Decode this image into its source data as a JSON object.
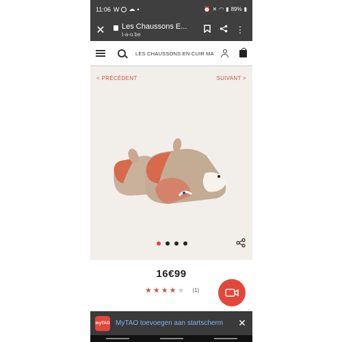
{
  "statusbar": {
    "time": "11:06",
    "battery": "89%"
  },
  "browser": {
    "title": "Les Chaussons E...",
    "domain": "t-a-o.be"
  },
  "site": {
    "breadcrumb": "LES CHAUSSONS EN CUIR MA..."
  },
  "product": {
    "prev": "< PRÉCÉDENT",
    "next": "SUIVANT >",
    "price": "16€99",
    "rating_count": "(1)",
    "rating": 4,
    "rating_max": 5,
    "image_count": 4,
    "active_image": 1
  },
  "banner": {
    "logo": "myTAO",
    "message": "MyTAO toevoegen aan startscherm"
  },
  "colors": {
    "accent": "#e2473a",
    "link": "#7fb4ff",
    "chrome": "#3f3f3f"
  }
}
